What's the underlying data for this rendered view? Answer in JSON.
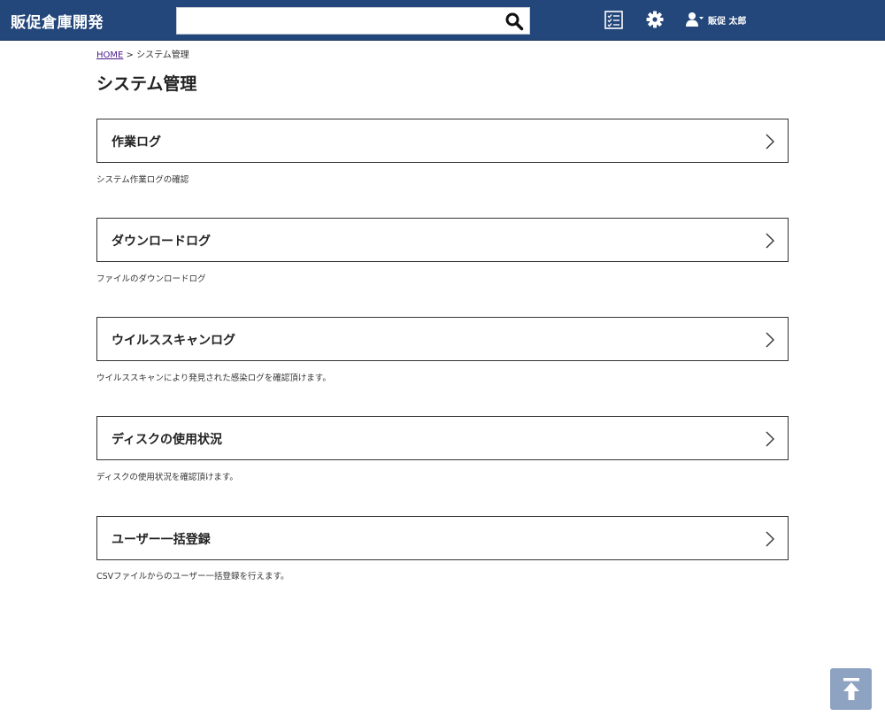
{
  "header": {
    "brand": "販促倉庫開発",
    "search": {
      "value": "",
      "placeholder": ""
    },
    "user_name": "販促 太郎"
  },
  "icons": {
    "search": "search-icon",
    "tasks": "checklist-icon",
    "settings": "gear-icon",
    "user": "user-icon",
    "card_arrow": "chevron-right-icon",
    "back_to_top": "arrow-up-to-top-icon"
  },
  "breadcrumb": {
    "home": "HOME",
    "separator": ">",
    "current": "システム管理"
  },
  "page": {
    "title": "システム管理"
  },
  "items": [
    {
      "label": "作業ログ",
      "description": "システム作業ログの確認"
    },
    {
      "label": "ダウンロードログ",
      "description": "ファイルのダウンロードログ"
    },
    {
      "label": "ウイルススキャンログ",
      "description": "ウイルススキャンにより発見された感染ログを確認頂けます。"
    },
    {
      "label": "ディスクの使用状況",
      "description": "ディスクの使用状況を確認頂けます。"
    },
    {
      "label": "ユーザー一括登録",
      "description": "CSVファイルからのユーザー一括登録を行えます。"
    }
  ],
  "colors": {
    "header_bg": "#23477a",
    "back_to_top_bg": "#8ea2c2",
    "link": "#4a1a8c"
  }
}
